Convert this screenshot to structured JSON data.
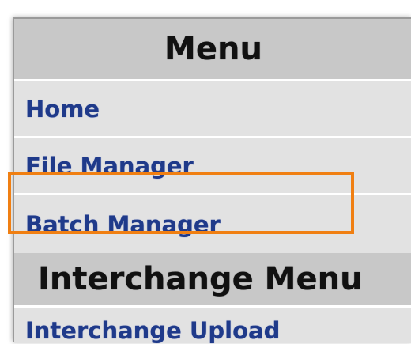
{
  "menu": {
    "title": "Menu",
    "items": [
      {
        "label": "Home"
      },
      {
        "label": "File Manager"
      },
      {
        "label": "Batch Manager"
      }
    ]
  },
  "interchange_menu": {
    "title": "Interchange Menu",
    "items": [
      {
        "label": "Interchange Upload"
      }
    ]
  },
  "highlight": {
    "target": "Batch Manager",
    "color": "#f07f12"
  },
  "colors": {
    "link": "#1f3a8a",
    "header_bg": "#c8c8c8",
    "row_bg": "#e2e2e2"
  }
}
